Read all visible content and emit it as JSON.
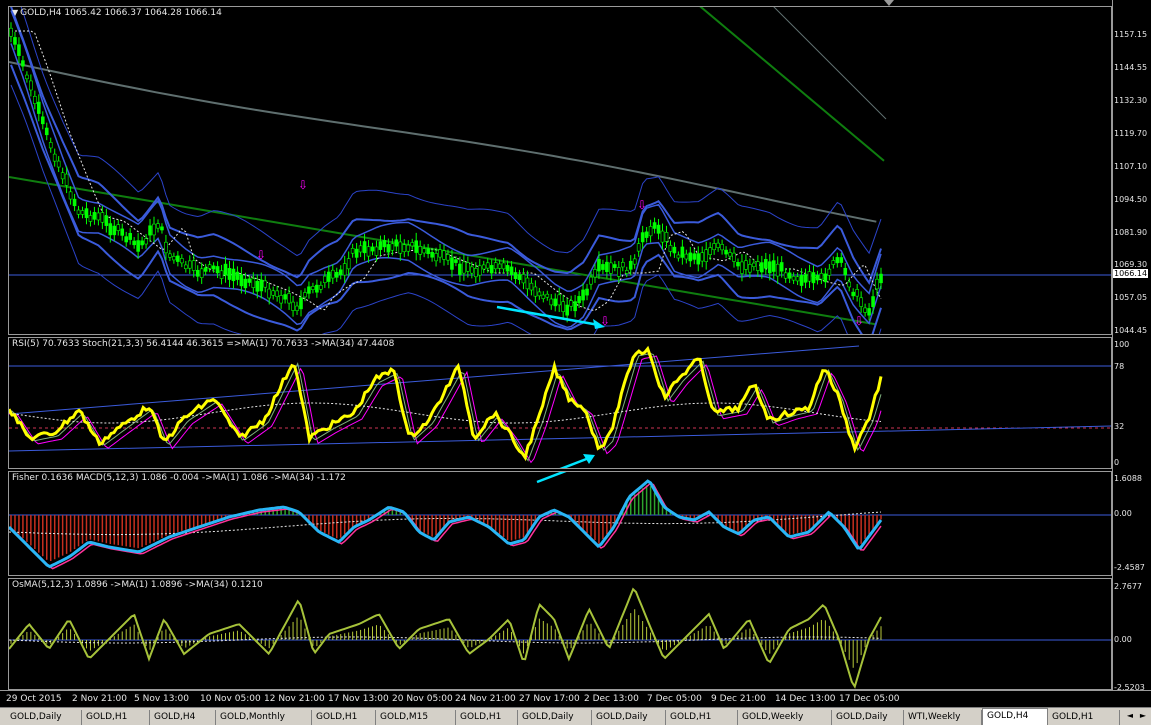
{
  "main": {
    "header": "GOLD,H4  1065.42 1066.37 1064.28 1066.14",
    "price_labels": [
      "1157.15",
      "1144.55",
      "1132.30",
      "1119.70",
      "1107.10",
      "1094.50",
      "1081.90",
      "1069.30",
      "1057.05",
      "1044.45"
    ],
    "current_price": "1066.14",
    "colors": {
      "bull": "#00ff00",
      "bear": "#00ff00",
      "bands": "#3b5bdb",
      "bands_thin": "#2b43c9",
      "ma_green": "#0f7d0f",
      "ma_gray": "#5f6f6f",
      "signal": "#ff00ff",
      "arrow": "#00e5ff"
    }
  },
  "rsi": {
    "header": "RSI(5) 70.7633  Stoch(21,3,3) 56.4144 46.3615  =>MA(1) 70.7633  ->MA(34) 47.4408",
    "labels": [
      "100",
      "78",
      "32",
      "0"
    ]
  },
  "macd": {
    "header": "Fisher 0.1636  MACD(5,12,3) 1.086 -0.004  ->MA(1) 1.086  ->MA(34) -1.172",
    "labels": [
      "1.6088",
      "0.00",
      "-2.4587"
    ]
  },
  "osma": {
    "header": "OsMA(5,12,3) 1.0896  ->MA(1) 1.0896  ->MA(34) 0.1210",
    "labels": [
      "2.7677",
      "0.00",
      "-2.5203"
    ]
  },
  "time_labels": [
    "29 Oct 2015",
    "2 Nov 21:00",
    "5 Nov 13:00",
    "10 Nov 05:00",
    "12 Nov 21:00",
    "17 Nov 13:00",
    "20 Nov 05:00",
    "24 Nov 21:00",
    "27 Nov 17:00",
    "2 Dec 13:00",
    "7 Dec 05:00",
    "9 Dec 21:00",
    "14 Dec 13:00",
    "17 Dec 05:00"
  ],
  "tabs": [
    "GOLD,Daily",
    "GOLD,H1",
    "GOLD,H4",
    "GOLD,Monthly",
    "GOLD,H1",
    "GOLD,M15",
    "GOLD,H1",
    "GOLD,Daily",
    "GOLD,Daily",
    "GOLD,H1",
    "GOLD,Weekly",
    "GOLD,Daily",
    "WTI,Weekly",
    "GOLD,H4",
    "GOLD,H1"
  ],
  "active_tab_index": 13
}
